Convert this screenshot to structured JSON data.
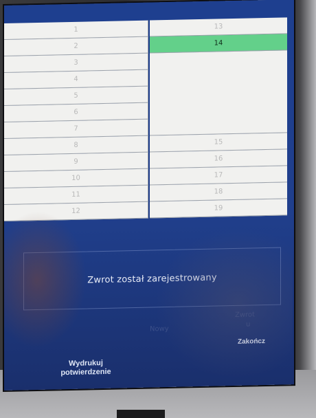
{
  "grid": {
    "left_rows": [
      "1",
      "2",
      "3",
      "4",
      "5",
      "6",
      "7",
      "8",
      "9",
      "10",
      "11",
      "12"
    ],
    "right_top": "13",
    "right_selected": "14",
    "right_bottom": [
      "15",
      "16",
      "17",
      "18",
      "19"
    ]
  },
  "message": "Zwrot został zarejestrowany",
  "ghost": {
    "center": "Nowy",
    "right_line1": "Zwrot",
    "right_line2": "u"
  },
  "buttons": {
    "print_line1": "Wydrukuj",
    "print_line2": "potwierdzenie",
    "finish": "Zakończ"
  },
  "colors": {
    "screen_blue": "#1e3f8f",
    "selected_green": "#63d08a",
    "cell_bg": "#f1f1ef"
  }
}
